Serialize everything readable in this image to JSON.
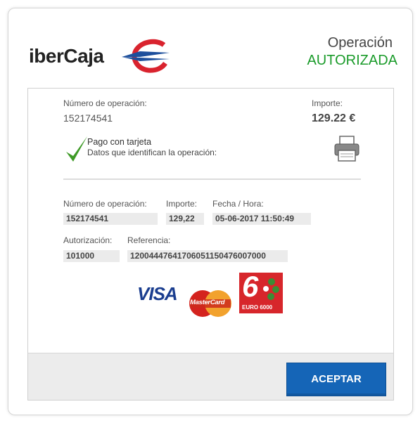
{
  "header": {
    "brand": "iberCaja",
    "operation_label": "Operación",
    "operation_status": "AUTORIZADA"
  },
  "summary": {
    "op_number_label": "Número de operación:",
    "op_number_value": "152174541",
    "amount_label": "Importe:",
    "amount_value": "129.22 €",
    "payment_title": "Pago con tarjeta",
    "payment_subtitle": "Datos que identifican la operación:"
  },
  "details": {
    "op_number_label": "Número de operación:",
    "op_number_value": "152174541",
    "amount_label": "Importe:",
    "amount_value": "129,22",
    "datetime_label": "Fecha / Hora:",
    "datetime_value": "05-06-2017 11:50:49",
    "auth_label": "Autorización:",
    "auth_value": "101000",
    "reference_label": "Referencia:",
    "reference_value": "12004447641706051150476007000"
  },
  "card_logos": {
    "visa": "VISA",
    "mastercard": "MasterCard",
    "euro6000": "EURO 6000",
    "euro6000_digit": "6"
  },
  "footer": {
    "accept_label": "ACEPTAR"
  },
  "colors": {
    "status_green": "#1a9b2a",
    "button_blue": "#1565b7",
    "brand_red": "#d9232e",
    "brand_blue": "#1d4f9c"
  }
}
